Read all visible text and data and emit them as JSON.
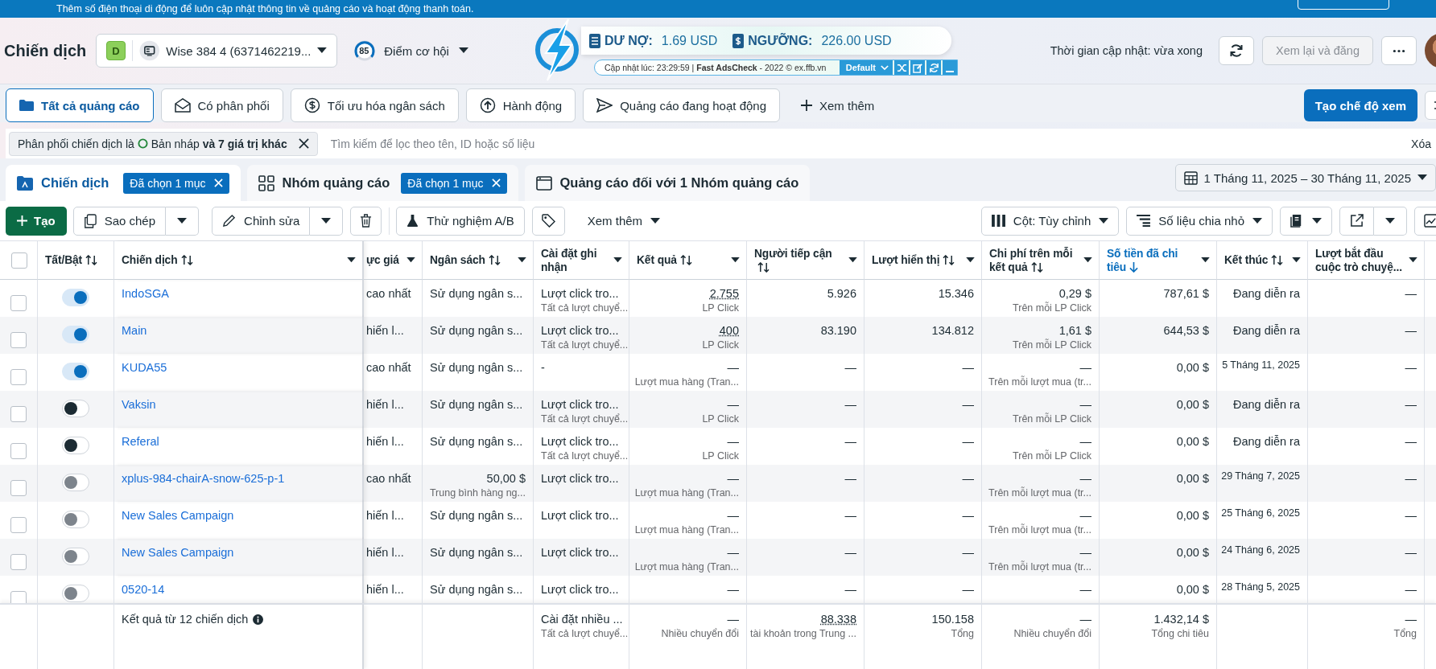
{
  "banner": {
    "text": "Thêm số điện thoại di động để luôn cập nhật thông tin về quảng cáo và hoạt động thanh toán."
  },
  "header": {
    "title": "Chiến dịch",
    "account": {
      "badge": "D",
      "name": "Wise 384 4 (6371462219..."
    },
    "score": {
      "value": "85",
      "label": "Điểm cơ hội"
    },
    "updated": "Thời gian cập nhật: vừa xong",
    "review": {
      "label": "Xem lại và đăng",
      "disabled": true
    }
  },
  "extension": {
    "debt_label": "DƯ NỢ:",
    "debt": "1.69 USD",
    "limit_label": "NGƯỠNG:",
    "limit": "226.00 USD",
    "status": "Cập nhật lúc: 23:29:59 | **Fast AdsCheck** - 2022 © ex.ffb.vn",
    "profile": "Default"
  },
  "filter_tabs": [
    {
      "label": "Tất cả quảng cáo",
      "kind": "folder",
      "selected": true
    },
    {
      "label": "Có phân phối",
      "kind": "envelope",
      "selected": false
    },
    {
      "label": "Tối ưu hóa ngân sách",
      "kind": "dollar",
      "selected": false
    },
    {
      "label": "Hành động",
      "kind": "upload",
      "selected": false
    },
    {
      "label": "Quảng cáo đang hoạt động",
      "kind": "send",
      "selected": false
    }
  ],
  "more_views": "Xem thêm",
  "create_view": "Tạo chế độ xem",
  "filter": {
    "prefix": "Phân phối chiến dịch là",
    "value": "Bản nháp **và 7 giá trị khác**",
    "placeholder": "Tìm kiếm để lọc theo tên, ID hoặc số liệu",
    "clear": "Xóa"
  },
  "level_tabs": [
    {
      "label": "Chiến dịch",
      "kind": "campaign",
      "selected": true,
      "chip": "Đã chọn 1 mục"
    },
    {
      "label": "Nhóm quảng cáo",
      "kind": "adset",
      "selected": false,
      "chip": "Đã chọn 1 mục"
    },
    {
      "label": "Quảng cáo đối với 1 Nhóm quảng cáo",
      "kind": "ad",
      "selected": false
    }
  ],
  "date_range": "1 Tháng 11, 2025 – 30 Tháng 11, 2025",
  "toolbar": {
    "create": "Tạo",
    "copy": "Sao chép",
    "edit": "Chỉnh sửa",
    "ab_test": "Thử nghiệm A/B",
    "more": "Xem thêm",
    "columns": "Cột: Tùy chỉnh",
    "breakdown": "Số liệu chia nhỏ"
  },
  "table": {
    "header_checked": false,
    "toggle_column": {
      "label": "Tất/Bật",
      "sortable": true
    },
    "name_column": {
      "label": "Chiến dịch",
      "sortable": true,
      "menu": true
    },
    "columns": [
      {
        "label": "ực giá",
        "kind": "text",
        "sortable": false,
        "sorted": false,
        "menu": true
      },
      {
        "label": "Ngân sách",
        "kind": "text",
        "sortable": true,
        "sorted": false,
        "menu": true
      },
      {
        "label": "Cài đặt ghi nhận",
        "kind": "text",
        "sortable": false,
        "sorted": false,
        "menu": true
      },
      {
        "label": "Kết quả",
        "kind": "number",
        "sortable": true,
        "sorted": false,
        "menu": true
      },
      {
        "label": "Người tiếp cận",
        "kind": "number",
        "sortable": true,
        "sorted": false,
        "menu": true
      },
      {
        "label": "Lượt hiển thị",
        "kind": "number",
        "sortable": true,
        "sorted": false,
        "menu": true
      },
      {
        "label": "Chi phí trên mỗi kết quả",
        "kind": "number",
        "sortable": true,
        "sorted": false,
        "menu": true
      },
      {
        "label": "Số tiền đã chi tiêu",
        "kind": "number",
        "sortable": true,
        "sorted": true,
        "menu": true
      },
      {
        "label": "Kết thúc",
        "kind": "number",
        "sortable": true,
        "sorted": false,
        "menu": true
      },
      {
        "label": "Lượt bắt đầu cuộc trò chuyệ...",
        "kind": "number",
        "sortable": false,
        "sorted": false,
        "menu": true
      }
    ],
    "rows": [
      {
        "name": "IndoSGA",
        "on": true,
        "disabled": false,
        "checked": false,
        "cells": [
          {
            "text": "cao nhất"
          },
          {
            "text": "Sử dụng ngân s..."
          },
          {
            "text": "Lượt click tro...",
            "sub": "Tất cả lượt chuyể..."
          },
          {
            "text": "2.755",
            "sub": "LP Click",
            "dotted": true
          },
          {
            "text": "5.926"
          },
          {
            "text": "15.346"
          },
          {
            "text": "0,29 $",
            "sub": "Trên mỗi LP Click"
          },
          {
            "text": "787,61 $"
          },
          {
            "text": "Đang diễn ra"
          },
          {
            "text": "—"
          }
        ]
      },
      {
        "name": "Main",
        "on": true,
        "disabled": false,
        "checked": false,
        "cells": [
          {
            "text": "hiến l..."
          },
          {
            "text": "Sử dụng ngân s..."
          },
          {
            "text": "Lượt click tro...",
            "sub": "Tất cả lượt chuyể..."
          },
          {
            "text": "400",
            "sub": "LP Click",
            "dotted": true
          },
          {
            "text": "83.190"
          },
          {
            "text": "134.812"
          },
          {
            "text": "1,61 $",
            "sub": "Trên mỗi LP Click"
          },
          {
            "text": "644,53 $"
          },
          {
            "text": "Đang diễn ra"
          },
          {
            "text": "—"
          }
        ]
      },
      {
        "name": "KUDA55",
        "on": true,
        "disabled": false,
        "checked": false,
        "cells": [
          {
            "text": "cao nhất"
          },
          {
            "text": "Sử dụng ngân s..."
          },
          {
            "text": "-"
          },
          {
            "text": "—",
            "sub": "Lượt mua hàng (Tran..."
          },
          {
            "text": "—"
          },
          {
            "text": "—"
          },
          {
            "text": "—",
            "sub": "Trên mỗi lượt mua (tr..."
          },
          {
            "text": "0,00 $"
          },
          {
            "text": "5 Tháng 11, 2025",
            "kind": "date"
          },
          {
            "text": "—"
          }
        ]
      },
      {
        "name": "Vaksin",
        "on": false,
        "disabled": false,
        "checked": false,
        "cells": [
          {
            "text": "hiến l..."
          },
          {
            "text": "Sử dụng ngân s..."
          },
          {
            "text": "Lượt click tro...",
            "sub": "Tất cả lượt chuyể..."
          },
          {
            "text": "—",
            "sub": "LP Click"
          },
          {
            "text": "—"
          },
          {
            "text": "—"
          },
          {
            "text": "—",
            "sub": "Trên mỗi LP Click"
          },
          {
            "text": "0,00 $"
          },
          {
            "text": "Đang diễn ra"
          },
          {
            "text": "—"
          }
        ]
      },
      {
        "name": "Referal",
        "on": false,
        "disabled": false,
        "checked": false,
        "cells": [
          {
            "text": "hiến l..."
          },
          {
            "text": "Sử dụng ngân s..."
          },
          {
            "text": "Lượt click tro...",
            "sub": "Tất cả lượt chuyể..."
          },
          {
            "text": "—",
            "sub": "LP Click"
          },
          {
            "text": "—"
          },
          {
            "text": "—"
          },
          {
            "text": "—",
            "sub": "Trên mỗi LP Click"
          },
          {
            "text": "0,00 $"
          },
          {
            "text": "Đang diễn ra"
          },
          {
            "text": "—"
          }
        ]
      },
      {
        "name": "xplus-984-chairA-snow-625-p-1",
        "on": false,
        "disabled": true,
        "checked": false,
        "cells": [
          {
            "text": "cao nhất"
          },
          {
            "text": "50,00 $",
            "sub": "Trung bình hàng ng...",
            "kind": "amount"
          },
          {
            "text": "Lượt click tro..."
          },
          {
            "text": "—",
            "sub": "Lượt mua hàng (Tran..."
          },
          {
            "text": "—"
          },
          {
            "text": "—"
          },
          {
            "text": "—",
            "sub": "Trên mỗi lượt mua (tr..."
          },
          {
            "text": "0,00 $"
          },
          {
            "text": "29 Tháng 7, 2025",
            "kind": "date"
          },
          {
            "text": "—"
          }
        ]
      },
      {
        "name": "New Sales Campaign",
        "on": false,
        "disabled": true,
        "checked": false,
        "cells": [
          {
            "text": "hiến l..."
          },
          {
            "text": "Sử dụng ngân s..."
          },
          {
            "text": "Lượt click tro..."
          },
          {
            "text": "—",
            "sub": "Lượt mua hàng (Tran..."
          },
          {
            "text": "—"
          },
          {
            "text": "—"
          },
          {
            "text": "—",
            "sub": "Trên mỗi lượt mua (tr..."
          },
          {
            "text": "0,00 $"
          },
          {
            "text": "25 Tháng 6, 2025",
            "kind": "date"
          },
          {
            "text": "—"
          }
        ]
      },
      {
        "name": "New Sales Campaign",
        "on": false,
        "disabled": true,
        "checked": false,
        "cells": [
          {
            "text": "hiến l..."
          },
          {
            "text": "Sử dụng ngân s..."
          },
          {
            "text": "Lượt click tro..."
          },
          {
            "text": "—",
            "sub": "Lượt mua hàng (Tran..."
          },
          {
            "text": "—"
          },
          {
            "text": "—"
          },
          {
            "text": "—",
            "sub": "Trên mỗi lượt mua (tr..."
          },
          {
            "text": "0,00 $"
          },
          {
            "text": "24 Tháng 6, 2025",
            "kind": "date"
          },
          {
            "text": "—"
          }
        ]
      },
      {
        "name": "0520-14",
        "on": false,
        "disabled": true,
        "checked": false,
        "cells": [
          {
            "text": "hiến l..."
          },
          {
            "text": "Sử dụng ngân s..."
          },
          {
            "text": "Lượt click tro..."
          },
          {
            "text": "—"
          },
          {
            "text": "—"
          },
          {
            "text": "—"
          },
          {
            "text": "—"
          },
          {
            "text": "0,00 $"
          },
          {
            "text": "28 Tháng 5, 2025",
            "kind": "date"
          },
          {
            "text": "—"
          }
        ]
      }
    ],
    "footer": {
      "label": "Kết quả từ 12 chiến dịch",
      "cells": [
        {},
        {},
        {
          "text": "Cài đặt nhiều ...",
          "sub": "Tất cả lượt chuyể..."
        },
        {
          "text": "—",
          "sub": "Nhiều chuyển đổi"
        },
        {
          "text": "88.338",
          "sub": "tài khoản trong Trung ...",
          "dotted": true
        },
        {
          "text": "150.158",
          "sub": "Tổng"
        },
        {
          "text": "—",
          "sub": "Nhiều chuyển đổi"
        },
        {
          "text": "1.432,14 $",
          "sub": "Tổng chi tiêu"
        },
        {},
        {
          "text": "—",
          "sub": "Tổng"
        }
      ]
    }
  }
}
